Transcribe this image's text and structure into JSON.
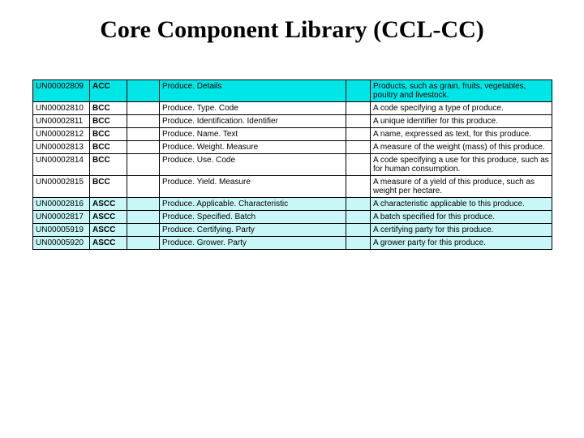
{
  "title": "Core Component Library (CCL-CC)",
  "rows": [
    {
      "id": "UN00002809",
      "code": "ACC",
      "name": "Produce. Details",
      "desc": "Products, such as grain, fruits, vegetables, poultry and livestock.",
      "type": "acc"
    },
    {
      "id": "UN00002810",
      "code": "BCC",
      "name": "Produce. Type. Code",
      "desc": "A code specifying a type of produce.",
      "type": "bcc"
    },
    {
      "id": "UN00002811",
      "code": "BCC",
      "name": "Produce. Identification. Identifier",
      "desc": "A unique identifier for this produce.",
      "type": "bcc"
    },
    {
      "id": "UN00002812",
      "code": "BCC",
      "name": "Produce. Name. Text",
      "desc": "A name, expressed as text, for this produce.",
      "type": "bcc"
    },
    {
      "id": "UN00002813",
      "code": "BCC",
      "name": "Produce. Weight. Measure",
      "desc": "A measure of the weight (mass) of this produce.",
      "type": "bcc"
    },
    {
      "id": "UN00002814",
      "code": "BCC",
      "name": "Produce. Use. Code",
      "desc": "A code specifying a use for this produce, such as for human consumption.",
      "type": "bcc"
    },
    {
      "id": "UN00002815",
      "code": "BCC",
      "name": "Produce. Yield. Measure",
      "desc": "A measure of a yield of this produce, such as weight per hectare.",
      "type": "bcc"
    },
    {
      "id": "UN00002816",
      "code": "ASCC",
      "name": "Produce. Applicable. Characteristic",
      "desc": "A characteristic applicable to this produce.",
      "type": "ascc"
    },
    {
      "id": "UN00002817",
      "code": "ASCC",
      "name": "Produce. Specified. Batch",
      "desc": "A batch specified for this produce.",
      "type": "ascc"
    },
    {
      "id": "UN00005919",
      "code": "ASCC",
      "name": "Produce. Certifying. Party",
      "desc": "A certifying party for this produce.",
      "type": "ascc"
    },
    {
      "id": "UN00005920",
      "code": "ASCC",
      "name": "Produce. Grower. Party",
      "desc": "A grower party for this produce.",
      "type": "ascc"
    }
  ]
}
